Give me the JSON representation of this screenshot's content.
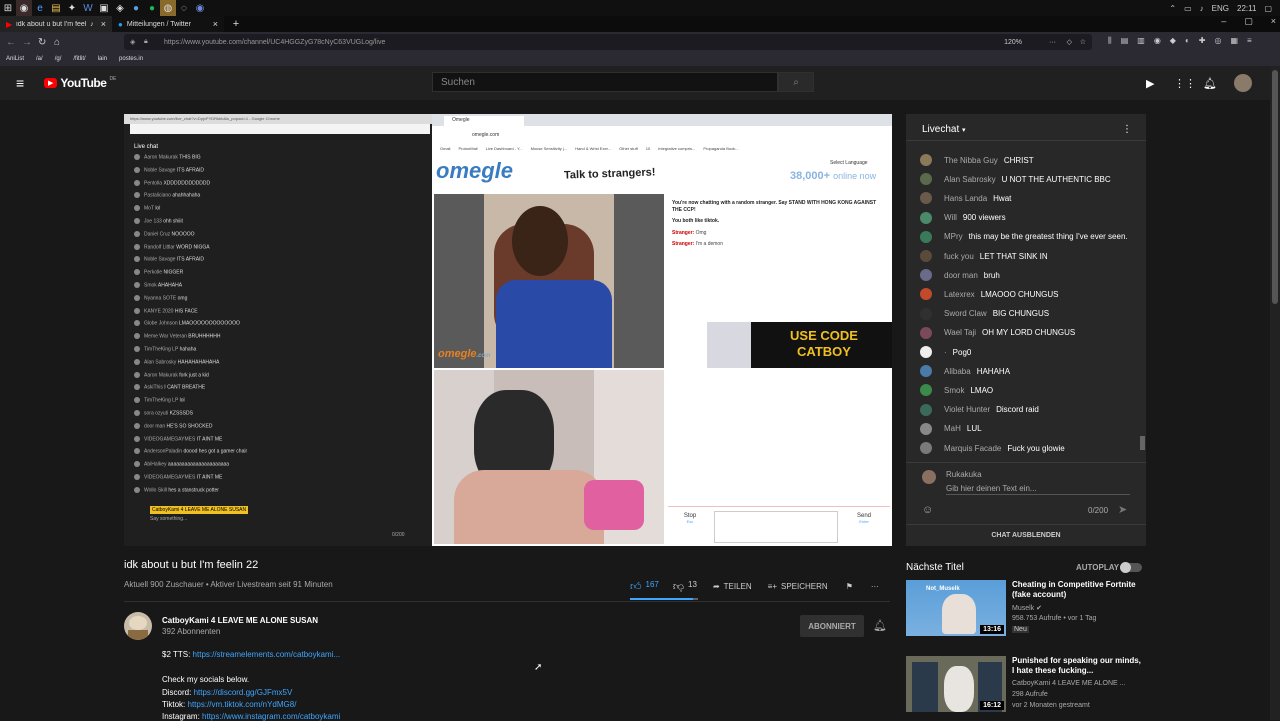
{
  "system": {
    "lang": "ENG",
    "time": "22:11"
  },
  "tabs": [
    {
      "label": "idk about u but I'm feelin 22",
      "icon": "youtube-icon"
    },
    {
      "label": "Mitteilungen / Twitter",
      "icon": "twitter-icon"
    }
  ],
  "browser": {
    "url": "https://www.youtube.com/channel/UC4HGGZyG78cNyC63VUGLog/live",
    "zoom": "120%"
  },
  "bookmarks": [
    "AniList",
    "/a/",
    "/g/",
    "/fitlit/",
    "lain",
    "postes.in"
  ],
  "header": {
    "logo": "YouTube",
    "country": "DE",
    "search_placeholder": "Suchen"
  },
  "stream": {
    "left_window_url": "https://www.youtube.com/live_chat?v=DpjxPYDRkbb&is_popout=1 - Google Chrome",
    "left_chat_title": "Live chat",
    "left_chat_rows": [
      [
        "Aaron Makurak",
        "THIS BIG"
      ],
      [
        "Noble Savage",
        "ITS AFRAID"
      ],
      [
        "Pentolla",
        "XDDDDDDDDDDDD"
      ],
      [
        "Pastaliciano",
        "ahahhahaha"
      ],
      [
        "MoT",
        "lol"
      ],
      [
        "Joe 133",
        "ohh shiiit"
      ],
      [
        "Daniel Cruz",
        "NOOOOO"
      ],
      [
        "Randolf Littlar",
        "WORD NIGGA"
      ],
      [
        "Noble Savage",
        "ITS AFRAID"
      ],
      [
        "Perkolle",
        "NIGGER"
      ],
      [
        "Smok",
        "AHAHAHA"
      ],
      [
        "Nyanna SOTE",
        "omg"
      ],
      [
        "KANYE 2020",
        "HIS FACE"
      ],
      [
        "Globe Johnson",
        "LMAOOOOOOOOOOOOO"
      ],
      [
        "Meme War Veteran",
        "BRUHHHHHH"
      ],
      [
        "TimTheKing LP",
        "hahaha"
      ],
      [
        "Alan Sabrosky",
        "HAHAHAHAHAHA"
      ],
      [
        "Aaron Makurak",
        "fork just a kid"
      ],
      [
        "AskiThis",
        "I CANT BREATHE"
      ],
      [
        "TimTheKing LP",
        "lol"
      ],
      [
        "sora ozyuti",
        "KZSSSDS"
      ],
      [
        "door man",
        "HE'S SO SHOCKED"
      ],
      [
        "VIDEOGAMEGAYMES",
        "IT AINT ME"
      ],
      [
        "AndersonPaladin",
        "doood hes got a gamer chair"
      ],
      [
        "AbiHalkey",
        "aaaaaaaaaaaaaaaaaaaaaa"
      ],
      [
        "VIDEOGAMEGAYMES",
        "IT AINT ME"
      ],
      [
        "Wollo Skill",
        "hes a stanstruck potter"
      ]
    ],
    "left_chat_highlight": "CatboyKami 4 LEAVE ME ALONE SUSAN",
    "left_chat_input": "Say something...",
    "left_chat_counter": "0/200",
    "omegle_tab": "Omegle",
    "omegle_url": "omegle.com",
    "omegle_bookmarks": [
      "Gmail",
      "ProtonMail",
      "Live Dashboard - Y...",
      "Mouse Sensitivity |...",
      "Hand & Wrist Exer...",
      "Other stuff",
      "10",
      "Integrative compris...",
      "Propaganda Book..."
    ],
    "omegle_logo": "omegle",
    "omegle_tagline": "Talk to strangers!",
    "omegle_online": "38,000+",
    "omegle_online_suffix": "online now",
    "omegle_select_language": "Select Language",
    "omegle_watermark": "omegle",
    "omegle_watermark_suffix": ".com",
    "chat_intro": "You're now chatting with a random stranger. Say STAND WITH HONG KONG AGAINST THE CCP!",
    "chat_common": "You both like tiktok.",
    "chat_lines": [
      [
        "Stranger:",
        "Omg"
      ],
      [
        "Stranger:",
        "I'm a demon"
      ]
    ],
    "promo": "USE CODE CATBOY",
    "stop_label": "Stop",
    "stop_hint": "Esc",
    "send_label": "Send",
    "send_hint": "Enter"
  },
  "livechat": {
    "title": "Livechat",
    "messages": [
      {
        "name": "The Nibba Guy",
        "msg": "CHRIST",
        "color": "#8a7a5a"
      },
      {
        "name": "Alan Sabrosky",
        "msg": "U NOT THE AUTHENTIC BBC",
        "color": "#5a6a4a"
      },
      {
        "name": "Hans Landa",
        "msg": "Hwat",
        "color": "#6a5a4a"
      },
      {
        "name": "Will",
        "msg": "900 viewers",
        "color": "#4a8a6a"
      },
      {
        "name": "MPry",
        "msg": "this may be the greatest thing I've ever seen.",
        "color": "#3a7a5a"
      },
      {
        "name": "fuck you",
        "msg": "LET THAT SINK IN",
        "color": "#5a4a3a"
      },
      {
        "name": "door man",
        "msg": "bruh",
        "color": "#6a6a8a"
      },
      {
        "name": "Latexrex",
        "msg": "LMAOOO CHUNGUS",
        "color": "#c04a2a"
      },
      {
        "name": "Sword Claw",
        "msg": "BIG CHUNGUS",
        "color": "#303030"
      },
      {
        "name": "Wael Taji",
        "msg": "OH MY LORD CHUNGUS",
        "color": "#7a4a5a"
      },
      {
        "name": "·",
        "msg": "Pog0",
        "color": "#eeeeee"
      },
      {
        "name": "Alibaba",
        "msg": "HAHAHA",
        "color": "#4a7aa8"
      },
      {
        "name": "Smok",
        "msg": "LMAO",
        "color": "#3a8a4a"
      },
      {
        "name": "Violet Hunter",
        "msg": "Discord raid",
        "color": "#3a6a5a"
      },
      {
        "name": "MaH",
        "msg": "LUL",
        "color": "#888888"
      },
      {
        "name": "Marquis Facade",
        "msg": "Fuck you glowie",
        "color": "#7a7a7a"
      }
    ],
    "user": "Rukakuka",
    "input_placeholder": "Gib hier deinen Text ein...",
    "counter": "0/200",
    "hide": "CHAT AUSBLENDEN"
  },
  "video": {
    "title": "idk about u but I'm feelin 22",
    "meta": "Aktuell 900 Zuschauer • Aktiver Livestream seit 91 Minuten",
    "likes": "167",
    "dislikes": "13",
    "share": "TEILEN",
    "save": "SPEICHERN",
    "like_ratio": 0.93
  },
  "channel": {
    "name": "CatboyKami 4 LEAVE ME ALONE SUSAN",
    "subs": "392 Abonnenten",
    "subscribe": "ABONNIERT"
  },
  "description": {
    "tts_label": "$2 TTS:",
    "tts_link": "https://streamelements.com/catboykami...",
    "socials": "Check my socials below.",
    "discord_label": "Discord:",
    "discord_link": "https://discord.gg/GJFmx5V",
    "tiktok_label": "Tiktok:",
    "tiktok_link": "https://vm.tiktok.com/nYdMG8/",
    "instagram_label": "Instagram:",
    "instagram_link": "https://www.instagram.com/catboykami"
  },
  "upnext": {
    "title": "Nächste Titel",
    "autoplay": "AUTOPLAY",
    "items": [
      {
        "title": "Cheating in Competitive Fortnite (fake account)",
        "channel": "Muselk",
        "views": "958.753 Aufrufe • vor 1 Tag",
        "badge": "Neu",
        "duration": "13:16",
        "thumb_text": "Not_Muselk"
      },
      {
        "title": "Punished for speaking our minds, I hate these fucking...",
        "channel": "CatboyKami 4 LEAVE ME ALONE ...",
        "views": "298 Aufrufe",
        "badge": "vor 2 Monaten gestreamt",
        "duration": "16:12",
        "thumb_text": ""
      }
    ]
  }
}
